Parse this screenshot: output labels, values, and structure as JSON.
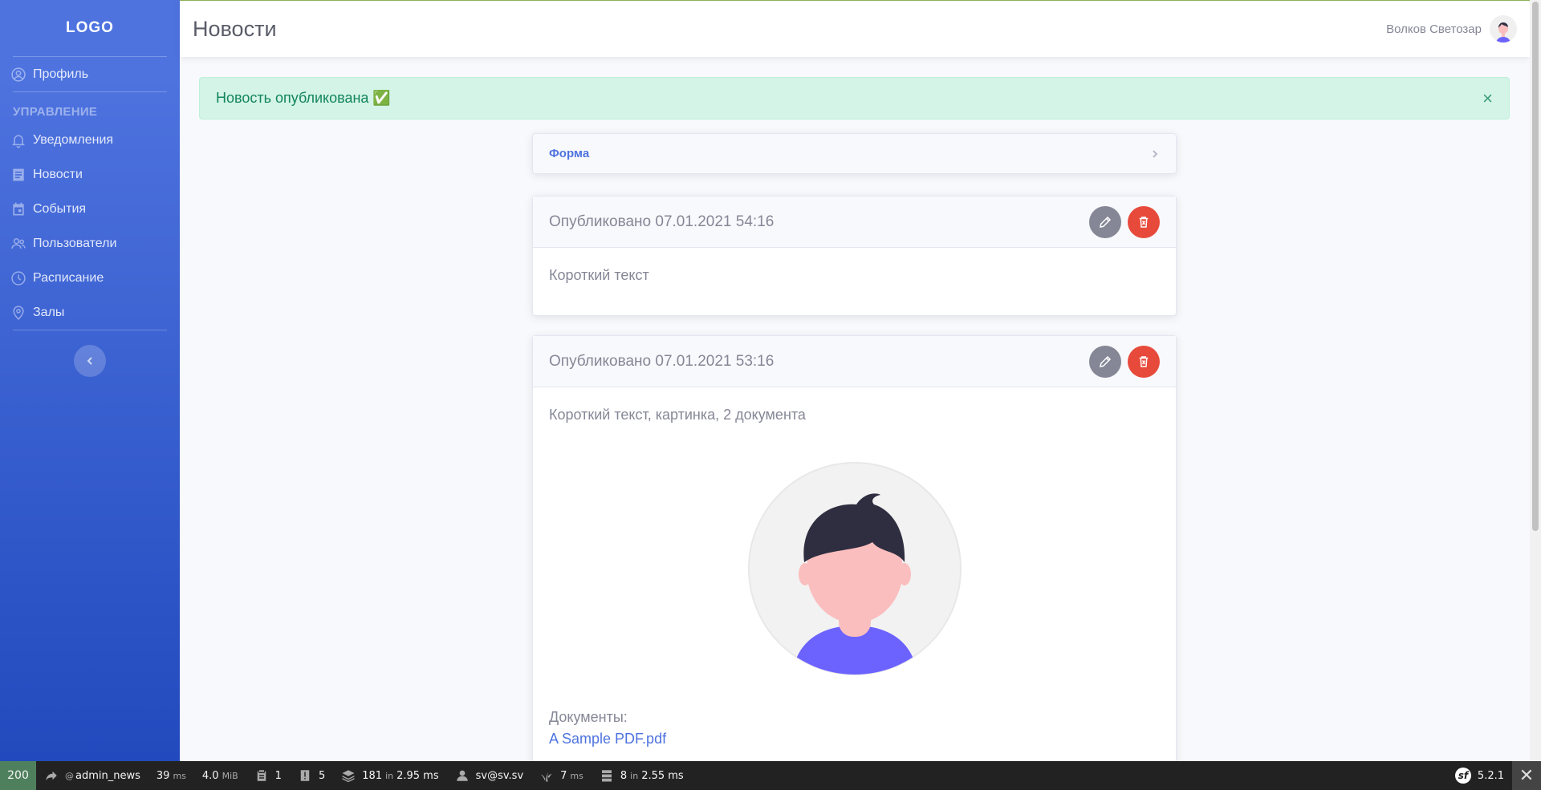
{
  "sidebar": {
    "brand": "LOGO",
    "profile": "Профиль",
    "heading": "УПРАВЛЕНИЕ",
    "items": [
      {
        "label": "Уведомления",
        "icon": "bell-icon"
      },
      {
        "label": "Новости",
        "icon": "newspaper-icon"
      },
      {
        "label": "События",
        "icon": "calendar-icon"
      },
      {
        "label": "Пользователи",
        "icon": "users-icon"
      },
      {
        "label": "Расписание",
        "icon": "clock-icon"
      },
      {
        "label": "Залы",
        "icon": "map-marker-icon"
      }
    ]
  },
  "topbar": {
    "title": "Новости",
    "user_name": "Волков Светозар"
  },
  "alert": {
    "text": "Новость опубликована ✅",
    "close": "×"
  },
  "form_card": {
    "title": "Форма"
  },
  "posts": [
    {
      "date": "Опубликовано 07.01.2021 54:16",
      "text": "Короткий текст"
    },
    {
      "date": "Опубликовано 07.01.2021 53:16",
      "text": "Короткий текст, картинка, 2 документа",
      "docs_label": "Документы:",
      "doc_link": "A Sample PDF.pdf"
    }
  ],
  "debug_toolbar": {
    "status": "200",
    "route": "admin_news",
    "route_prefix": "@",
    "time": "39",
    "time_unit": "ms",
    "memory": "4.0",
    "memory_unit": "MiB",
    "logs": "1",
    "warnings": "5",
    "templates": "181",
    "templates_in": "in",
    "templates_time": "2.95 ms",
    "user": "sv@sv.sv",
    "twig_time": "7",
    "twig_unit": "ms",
    "db_queries": "8",
    "db_in": "in",
    "db_time": "2.55 ms",
    "version": "5.2.1",
    "close": "✕"
  },
  "colors": {
    "sidebar": "#4e73df",
    "alert_bg": "#d3f4e6",
    "danger": "#e74a3b",
    "secondary": "#858796"
  }
}
